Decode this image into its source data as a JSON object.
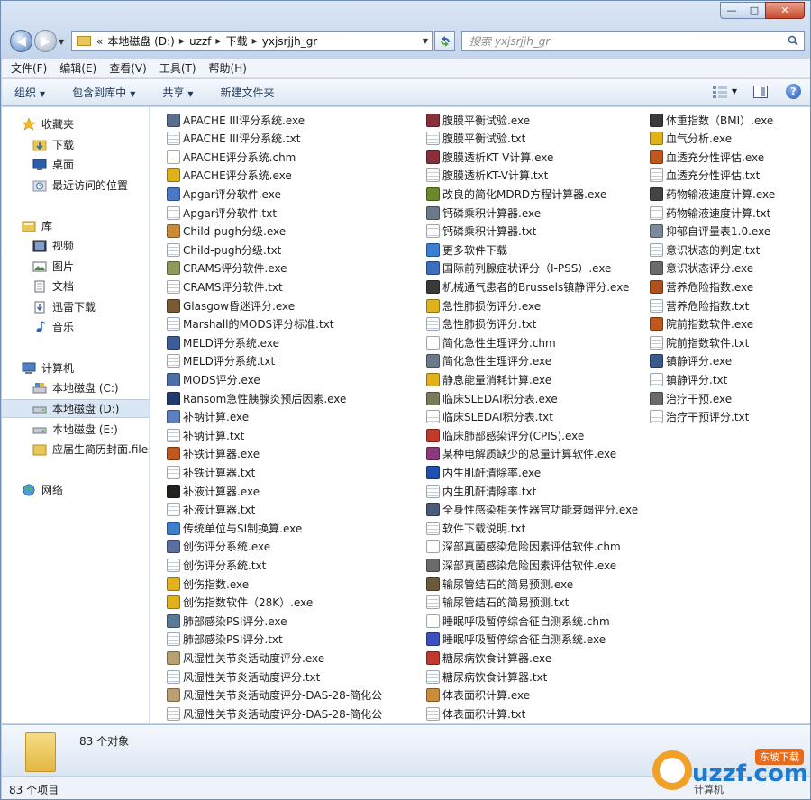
{
  "window": {
    "caption_min": "—",
    "caption_max": "□",
    "caption_close": "✕"
  },
  "nav": {
    "back_glyph": "◀",
    "forward_glyph": "▶",
    "address": {
      "overflow": "«",
      "parts": [
        "本地磁盘 (D:)",
        "uzzf",
        "下载",
        "yxjsrjjh_gr"
      ]
    },
    "search_placeholder": "搜索 yxjsrjjh_gr"
  },
  "menu": [
    "文件(F)",
    "编辑(E)",
    "查看(V)",
    "工具(T)",
    "帮助(H)"
  ],
  "commands": [
    "组织",
    "包含到库中",
    "共享",
    "新建文件夹"
  ],
  "sidebar": {
    "favorites": {
      "label": "收藏夹",
      "items": [
        "下载",
        "桌面",
        "最近访问的位置"
      ]
    },
    "libraries": {
      "label": "库",
      "items": [
        "视频",
        "图片",
        "文档",
        "迅雷下载",
        "音乐"
      ]
    },
    "computer": {
      "label": "计算机",
      "items": [
        "本地磁盘 (C:)",
        "本地磁盘 (D:)",
        "本地磁盘 (E:)",
        "应届生简历封面.files"
      ]
    },
    "network": {
      "label": "网络"
    }
  },
  "files": {
    "col1": [
      {
        "name": "APACHE III评分系统.exe",
        "kind": "exe",
        "color": "#5a6f8c"
      },
      {
        "name": "APACHE III评分系统.txt",
        "kind": "txt"
      },
      {
        "name": "APACHE评分系统.chm",
        "kind": "chm"
      },
      {
        "name": "APACHE评分系统.exe",
        "kind": "exe",
        "color": "#e0b21c"
      },
      {
        "name": "Apgar评分软件.exe",
        "kind": "exe",
        "color": "#4a78c8"
      },
      {
        "name": "Apgar评分软件.txt",
        "kind": "txt"
      },
      {
        "name": "Child-pugh分级.exe",
        "kind": "exe",
        "color": "#c98c3a"
      },
      {
        "name": "Child-pugh分级.txt",
        "kind": "txt"
      },
      {
        "name": "CRAMS评分软件.exe",
        "kind": "exe",
        "color": "#8f9a5c"
      },
      {
        "name": "CRAMS评分软件.txt",
        "kind": "txt"
      },
      {
        "name": "Glasgow昏迷评分.exe",
        "kind": "exe",
        "color": "#7a5a32"
      },
      {
        "name": "Marshall的MODS评分标准.txt",
        "kind": "txt"
      },
      {
        "name": "MELD评分系统.exe",
        "kind": "exe",
        "color": "#3c5c9a"
      },
      {
        "name": "MELD评分系统.txt",
        "kind": "txt"
      },
      {
        "name": "MODS评分.exe",
        "kind": "exe",
        "color": "#4d6fa8"
      },
      {
        "name": "Ransom急性胰腺炎预后因素.exe",
        "kind": "exe",
        "color": "#223a6e"
      },
      {
        "name": "补钠计算.exe",
        "kind": "exe",
        "color": "#5d7fc0"
      },
      {
        "name": "补钠计算.txt",
        "kind": "txt"
      },
      {
        "name": "补铁计算器.exe",
        "kind": "exe",
        "color": "#c0571d"
      },
      {
        "name": "补铁计算器.txt",
        "kind": "txt"
      },
      {
        "name": "补液计算器.exe",
        "kind": "exe",
        "color": "#222222"
      },
      {
        "name": "补液计算器.txt",
        "kind": "txt"
      },
      {
        "name": "传统单位与SI制换算.exe",
        "kind": "exe",
        "color": "#3f7fd0"
      },
      {
        "name": "创伤评分系统.exe",
        "kind": "exe",
        "color": "#5a6fa0"
      },
      {
        "name": "创伤评分系统.txt",
        "kind": "txt"
      },
      {
        "name": "创伤指数.exe",
        "kind": "exe",
        "color": "#e2b21c"
      },
      {
        "name": "创伤指数软件（28K）.exe",
        "kind": "exe",
        "color": "#e2b21c"
      },
      {
        "name": "肺部感染PSI评分.exe",
        "kind": "exe",
        "color": "#5a7a9a"
      },
      {
        "name": "肺部感染PSI评分.txt",
        "kind": "txt"
      },
      {
        "name": "风湿性关节炎活动度评分.exe",
        "kind": "exe",
        "color": "#b8a070"
      },
      {
        "name": "风湿性关节炎活动度评分.txt",
        "kind": "txt"
      },
      {
        "name": "风湿性关节炎活动度评分-DAS-28-简化公式.exe",
        "kind": "exe",
        "color": "#b8a070"
      },
      {
        "name": "风湿性关节炎活动度评分-DAS-28-简化公式.txt",
        "kind": "txt"
      }
    ],
    "col2": [
      {
        "name": "腹膜平衡试验.exe",
        "kind": "exe",
        "color": "#8a2f3a"
      },
      {
        "name": "腹膜平衡试验.txt",
        "kind": "txt"
      },
      {
        "name": "腹膜透析KT V计算.exe",
        "kind": "exe",
        "color": "#8a2f3a"
      },
      {
        "name": "腹膜透析KT-V计算.txt",
        "kind": "txt"
      },
      {
        "name": "改良的简化MDRD方程计算器.exe",
        "kind": "exe",
        "color": "#6a8a2a"
      },
      {
        "name": "钙磷乘积计算器.exe",
        "kind": "exe",
        "color": "#6a7a8a"
      },
      {
        "name": "钙磷乘积计算器.txt",
        "kind": "txt"
      },
      {
        "name": "更多软件下载",
        "kind": "exe",
        "color": "#3a7fd6"
      },
      {
        "name": "国际前列腺症状评分（I-PSS）.exe",
        "kind": "exe",
        "color": "#3a6fc0"
      },
      {
        "name": "机械通气患者的Brussels镇静评分.exe",
        "kind": "exe",
        "color": "#3a3a3a"
      },
      {
        "name": "急性肺损伤评分.exe",
        "kind": "exe",
        "color": "#e0b21c"
      },
      {
        "name": "急性肺损伤评分.txt",
        "kind": "txt"
      },
      {
        "name": "简化急性生理评分.chm",
        "kind": "chm"
      },
      {
        "name": "简化急性生理评分.exe",
        "kind": "exe",
        "color": "#6a7a8a"
      },
      {
        "name": "静息能量消耗计算.exe",
        "kind": "exe",
        "color": "#e0b21c"
      },
      {
        "name": "临床SLEDAI积分表.exe",
        "kind": "exe",
        "color": "#7a7a5a"
      },
      {
        "name": "临床SLEDAI积分表.txt",
        "kind": "txt"
      },
      {
        "name": "临床肺部感染评分(CPIS).exe",
        "kind": "exe",
        "color": "#c0392b"
      },
      {
        "name": "某种电解质缺少的总量计算软件.exe",
        "kind": "exe",
        "color": "#8a3a7a"
      },
      {
        "name": "内生肌酐清除率.exe",
        "kind": "exe",
        "color": "#1f4fb0"
      },
      {
        "name": "内生肌酐清除率.txt",
        "kind": "txt"
      },
      {
        "name": "全身性感染相关性器官功能衰竭评分.exe",
        "kind": "exe",
        "color": "#4a5a7a"
      },
      {
        "name": "软件下载说明.txt",
        "kind": "txt"
      },
      {
        "name": "深部真菌感染危险因素评估软件.chm",
        "kind": "chm"
      },
      {
        "name": "深部真菌感染危险因素评估软件.exe",
        "kind": "exe",
        "color": "#6a6a6a"
      },
      {
        "name": "输尿管结石的简易预测.exe",
        "kind": "exe",
        "color": "#6a5a3a"
      },
      {
        "name": "输尿管结石的简易预测.txt",
        "kind": "txt"
      },
      {
        "name": "睡眠呼吸暂停综合征自测系统.chm",
        "kind": "chm"
      },
      {
        "name": "睡眠呼吸暂停综合征自测系统.exe",
        "kind": "exe",
        "color": "#3a4fc0"
      },
      {
        "name": "糖尿病饮食计算器.exe",
        "kind": "exe",
        "color": "#c0392b"
      },
      {
        "name": "糖尿病饮食计算器.txt",
        "kind": "txt"
      },
      {
        "name": "体表面积计算.exe",
        "kind": "exe",
        "color": "#c98c3a"
      },
      {
        "name": "体表面积计算.txt",
        "kind": "txt"
      }
    ],
    "col3": [
      {
        "name": "体重指数（BMI）.exe",
        "kind": "exe",
        "color": "#3a3a3a"
      },
      {
        "name": "血气分析.exe",
        "kind": "exe",
        "color": "#e0b21c"
      },
      {
        "name": "血透充分性评估.exe",
        "kind": "exe",
        "color": "#c0571d"
      },
      {
        "name": "血透充分性评估.txt",
        "kind": "txt"
      },
      {
        "name": "药物输液速度计算.exe",
        "kind": "exe",
        "color": "#444444"
      },
      {
        "name": "药物输液速度计算.txt",
        "kind": "txt"
      },
      {
        "name": "抑郁自评量表1.0.exe",
        "kind": "exe",
        "color": "#7a8a9a"
      },
      {
        "name": "意识状态的判定.txt",
        "kind": "txt"
      },
      {
        "name": "意识状态评分.exe",
        "kind": "exe",
        "color": "#6a6a6a"
      },
      {
        "name": "营养危险指数.exe",
        "kind": "exe",
        "color": "#b0501d"
      },
      {
        "name": "营养危险指数.txt",
        "kind": "txt"
      },
      {
        "name": "院前指数软件.exe",
        "kind": "exe",
        "color": "#c0571d"
      },
      {
        "name": "院前指数软件.txt",
        "kind": "txt"
      },
      {
        "name": "镇静评分.exe",
        "kind": "exe",
        "color": "#3a5a8a"
      },
      {
        "name": "镇静评分.txt",
        "kind": "txt"
      },
      {
        "name": "治疗干预.exe",
        "kind": "exe",
        "color": "#6a6a6a"
      },
      {
        "name": "治疗干预评分.txt",
        "kind": "txt"
      }
    ]
  },
  "details": {
    "count": "83 个对象"
  },
  "status": {
    "text": "83 个项目",
    "computer": "计算机"
  },
  "watermark": {
    "text": "uzzf.com",
    "badge": "东坡下载"
  },
  "colors": {
    "accent": "#3a6bb0",
    "folder": "#e7c65a",
    "selection": "#d9e6f5"
  }
}
